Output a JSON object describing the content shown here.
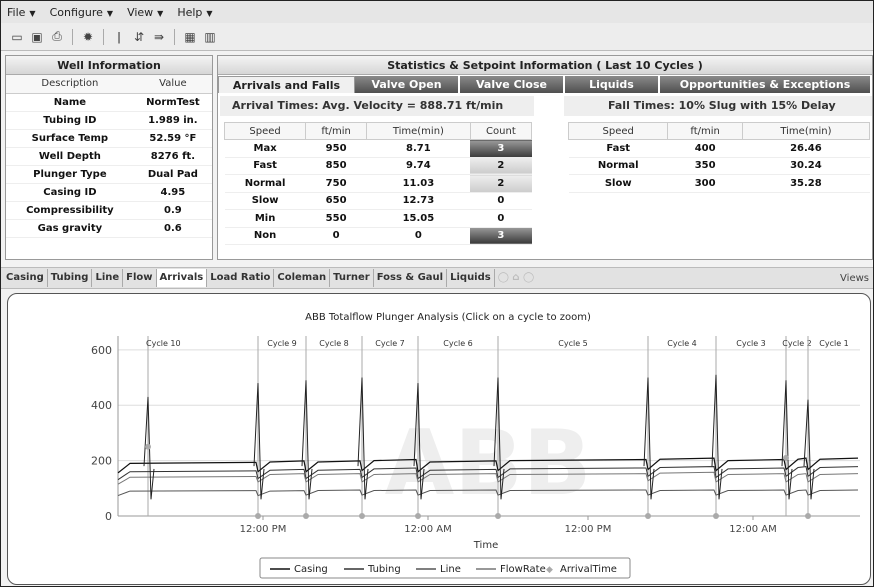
{
  "menu": [
    {
      "label": "File"
    },
    {
      "label": "Configure"
    },
    {
      "label": "View"
    },
    {
      "label": "Help"
    }
  ],
  "toolbar_icons": [
    "new-icon",
    "save-icon",
    "print-icon",
    "settings-icon",
    "info-icon",
    "sync-icon",
    "forward-icon",
    "table-icon",
    "chart-icon"
  ],
  "well": {
    "title": "Well Information",
    "headers": [
      "Description",
      "Value"
    ],
    "rows": [
      [
        "Name",
        "NormTest"
      ],
      [
        "Tubing ID",
        "1.989 in."
      ],
      [
        "Surface Temp",
        "52.59 °F"
      ],
      [
        "Well Depth",
        "8276 ft."
      ],
      [
        "Plunger Type",
        "Dual Pad"
      ],
      [
        "Casing ID",
        "4.95"
      ],
      [
        "Compressibility",
        "0.9"
      ],
      [
        "Gas gravity",
        "0.6"
      ]
    ]
  },
  "stats": {
    "title": "Statistics & Setpoint Information ( Last 10 Cycles )",
    "tabs": [
      "Arrivals and Falls",
      "Valve Open",
      "Valve Close",
      "Liquids",
      "Opportunities & Exceptions"
    ],
    "arrival_header": "Arrival Times:  Avg. Velocity = 888.71 ft/min",
    "arrival_cols": [
      "Speed",
      "ft/min",
      "Time(min)",
      "Count"
    ],
    "arrival_rows": [
      [
        "Max",
        "950",
        "8.71",
        "3"
      ],
      [
        "Fast",
        "850",
        "9.74",
        "2"
      ],
      [
        "Normal",
        "750",
        "11.03",
        "2"
      ],
      [
        "Slow",
        "650",
        "12.73",
        "0"
      ],
      [
        "Min",
        "550",
        "15.05",
        "0"
      ],
      [
        "Non",
        "0",
        "0",
        "3"
      ]
    ],
    "fall_header": "Fall Times:   10% Slug with 15% Delay",
    "fall_cols": [
      "Speed",
      "ft/min",
      "Time(min)"
    ],
    "fall_rows": [
      [
        "Fast",
        "400",
        "26.46"
      ],
      [
        "Normal",
        "350",
        "30.24"
      ],
      [
        "Slow",
        "300",
        "35.28"
      ]
    ]
  },
  "chart_tabs": [
    "Casing",
    "Tubing",
    "Line",
    "Flow",
    "Arrivals",
    "Load Ratio",
    "Coleman",
    "Turner",
    "Foss & Gaul",
    "Liquids"
  ],
  "views_label": "Views",
  "chart_data": {
    "type": "line",
    "title": "ABB Totalflow Plunger Analysis    (Click on a cycle to zoom)",
    "xlabel": "Time",
    "ylabel": "",
    "ylim": [
      0,
      650
    ],
    "yticks": [
      0,
      200,
      400,
      600
    ],
    "xticks": [
      "12:00 PM",
      "12:00 AM",
      "12:00 PM",
      "12:00 AM"
    ],
    "watermark": "ABB",
    "cycles": [
      "Cycle 10",
      "Cycle 9",
      "Cycle 8",
      "Cycle 7",
      "Cycle 6",
      "Cycle 5",
      "Cycle 4",
      "Cycle 3",
      "Cycle 2",
      "Cycle 1"
    ],
    "series": [
      {
        "name": "Casing",
        "values": [
          190,
          195,
          195,
          200,
          195,
          200,
          205,
          200,
          205,
          205
        ]
      },
      {
        "name": "Tubing",
        "values": [
          160,
          165,
          165,
          170,
          165,
          170,
          175,
          170,
          175,
          175
        ]
      },
      {
        "name": "Line",
        "values": [
          90,
          90,
          92,
          92,
          92,
          92,
          92,
          92,
          92,
          92
        ]
      },
      {
        "name": "FlowRate",
        "values": [
          140,
          150,
          150,
          150,
          150,
          150,
          155,
          150,
          150,
          150
        ]
      },
      {
        "name": "ArrivalTime",
        "values": [
          250,
          0,
          0,
          0,
          0,
          0,
          0,
          0,
          210,
          0
        ]
      }
    ],
    "legend": [
      "Casing",
      "Tubing",
      "Line",
      "FlowRate",
      "ArrivalTime"
    ],
    "legend_position": "bottom"
  }
}
